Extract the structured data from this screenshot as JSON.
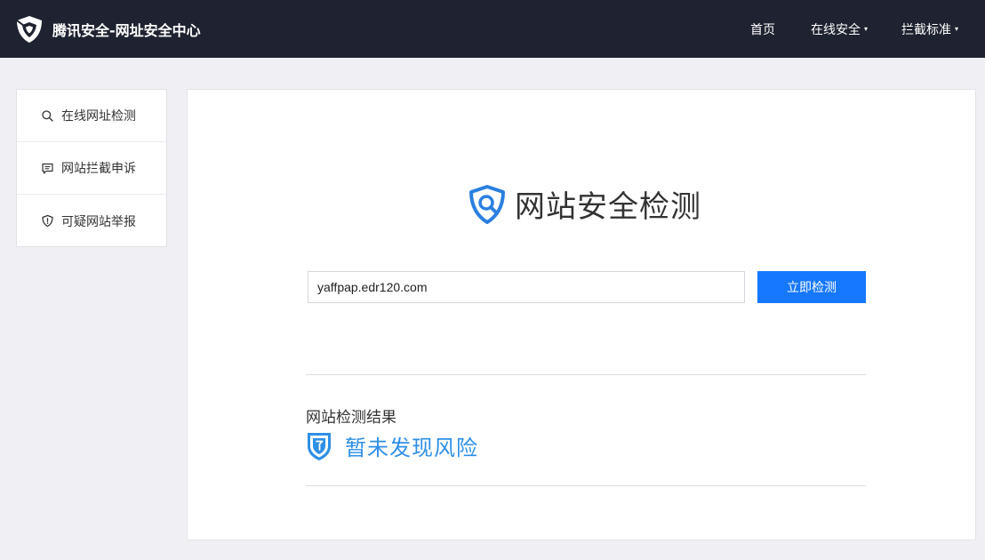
{
  "header": {
    "title": "腾讯安全-网址安全中心",
    "logo_icon": "tencent-security-logo-icon",
    "nav": {
      "home_label": "首页",
      "online_security_label": "在线安全",
      "block_standard_label": "拦截标准",
      "caret": "▾"
    }
  },
  "sidebar": {
    "items": [
      {
        "label": "在线网址检测",
        "icon": "search-icon"
      },
      {
        "label": "网站拦截申诉",
        "icon": "chat-bubble-icon"
      },
      {
        "label": "可疑网站举报",
        "icon": "shield-alert-icon"
      }
    ]
  },
  "main": {
    "heading": "网站安全检测",
    "heading_icon": "shield-search-icon",
    "search": {
      "value": "yaffpap.edr120.com",
      "button_label": "立即检测"
    },
    "result": {
      "label": "网站检测结果",
      "status_text": "暂未发现风险",
      "status_icon": "shield-safe-icon"
    }
  },
  "colors": {
    "header_bg": "#1f2230",
    "accent_blue": "#1677ff",
    "result_blue": "#2e8fe6",
    "page_bg": "#f0f0f4"
  }
}
